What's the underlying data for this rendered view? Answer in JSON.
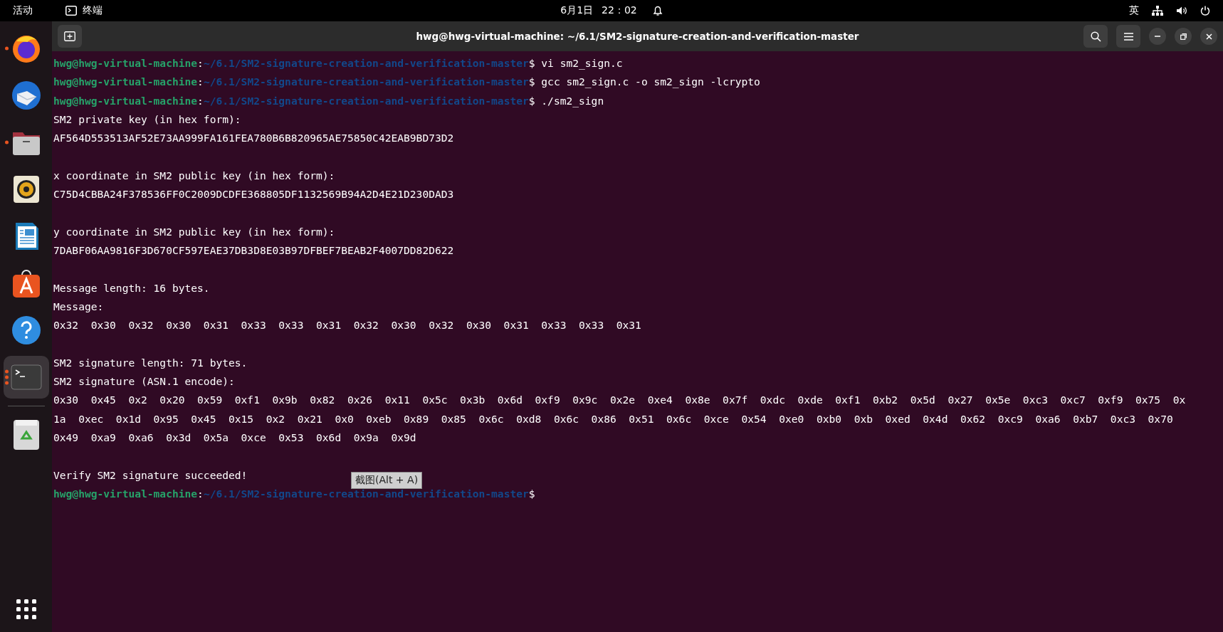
{
  "top_bar": {
    "activities": "活动",
    "app_name": "终端",
    "date": "6月1日",
    "time": "22：02",
    "input_method": "英"
  },
  "dock": {
    "items": [
      {
        "kind": "firefox",
        "running": true,
        "selected": false
      },
      {
        "kind": "mail",
        "running": false,
        "selected": false
      },
      {
        "kind": "files",
        "running": true,
        "selected": false
      },
      {
        "kind": "speaker",
        "running": false,
        "selected": false
      },
      {
        "kind": "writer",
        "running": false,
        "selected": false
      },
      {
        "kind": "store",
        "running": false,
        "selected": false
      },
      {
        "kind": "help",
        "running": false,
        "selected": false
      },
      {
        "kind": "terminal",
        "running": true,
        "selected": true
      },
      {
        "kind": "trash",
        "running": false,
        "selected": false
      }
    ]
  },
  "window": {
    "title": "hwg@hwg-virtual-machine: ~/6.1/SM2-signature-creation-and-verification-master"
  },
  "terminal": {
    "lines": [
      {
        "kind": "prompt",
        "user": "hwg@hwg-virtual-machine",
        "separator": ":",
        "path": "~/6.1/SM2-signature-creation-and-verification-master",
        "sign": "$",
        "command": "vi sm2_sign.c"
      },
      {
        "kind": "prompt",
        "user": "hwg@hwg-virtual-machine",
        "separator": ":",
        "path": "~/6.1/SM2-signature-creation-and-verification-master",
        "sign": "$",
        "command": "gcc sm2_sign.c -o sm2_sign -lcrypto"
      },
      {
        "kind": "prompt",
        "user": "hwg@hwg-virtual-machine",
        "separator": ":",
        "path": "~/6.1/SM2-signature-creation-and-verification-master",
        "sign": "$",
        "command": "./sm2_sign"
      },
      {
        "kind": "output",
        "text": "SM2 private key (in hex form):"
      },
      {
        "kind": "output",
        "text": "AF564D553513AF52E73AA999FA161FEA780B6B820965AE75850C42EAB9BD73D2"
      },
      {
        "kind": "blank"
      },
      {
        "kind": "output",
        "text": "x coordinate in SM2 public key (in hex form):"
      },
      {
        "kind": "output",
        "text": "C75D4CBBA24F378536FF0C2009DCDFE368805DF1132569B94A2D4E21D230DAD3"
      },
      {
        "kind": "blank"
      },
      {
        "kind": "output",
        "text": "y coordinate in SM2 public key (in hex form):"
      },
      {
        "kind": "output",
        "text": "7DABF06AA9816F3D670CF597EAE37DB3D8E03B97DFBEF7BEAB2F4007DD82D622"
      },
      {
        "kind": "blank"
      },
      {
        "kind": "output",
        "text": "Message length: 16 bytes."
      },
      {
        "kind": "output",
        "text": "Message:"
      },
      {
        "kind": "output",
        "text": "0x32  0x30  0x32  0x30  0x31  0x33  0x33  0x31  0x32  0x30  0x32  0x30  0x31  0x33  0x33  0x31"
      },
      {
        "kind": "blank"
      },
      {
        "kind": "output",
        "text": "SM2 signature length: 71 bytes."
      },
      {
        "kind": "output",
        "text": "SM2 signature (ASN.1 encode):"
      },
      {
        "kind": "output",
        "text": "0x30  0x45  0x2  0x20  0x59  0xf1  0x9b  0x82  0x26  0x11  0x5c  0x3b  0x6d  0xf9  0x9c  0x2e  0xe4  0x8e  0x7f  0xdc  0xde  0xf1  0xb2  0x5d  0x27  0x5e  0xc3  0xc7  0xf9  0x75  0x"
      },
      {
        "kind": "output",
        "text": "1a  0xec  0x1d  0x95  0x45  0x15  0x2  0x21  0x0  0xeb  0x89  0x85  0x6c  0xd8  0x6c  0x86  0x51  0x6c  0xce  0x54  0xe0  0xb0  0xb  0xed  0x4d  0x62  0xc9  0xa6  0xb7  0xc3  0x70"
      },
      {
        "kind": "output",
        "text": "0x49  0xa9  0xa6  0x3d  0x5a  0xce  0x53  0x6d  0x9a  0x9d"
      },
      {
        "kind": "blank"
      },
      {
        "kind": "output",
        "text": "Verify SM2 signature succeeded!"
      },
      {
        "kind": "prompt",
        "user": "hwg@hwg-virtual-machine",
        "separator": ":",
        "path": "~/6.1/SM2-signature-creation-and-verification-master",
        "sign": "$"
      }
    ]
  },
  "tooltip": "截图(Alt + A)"
}
